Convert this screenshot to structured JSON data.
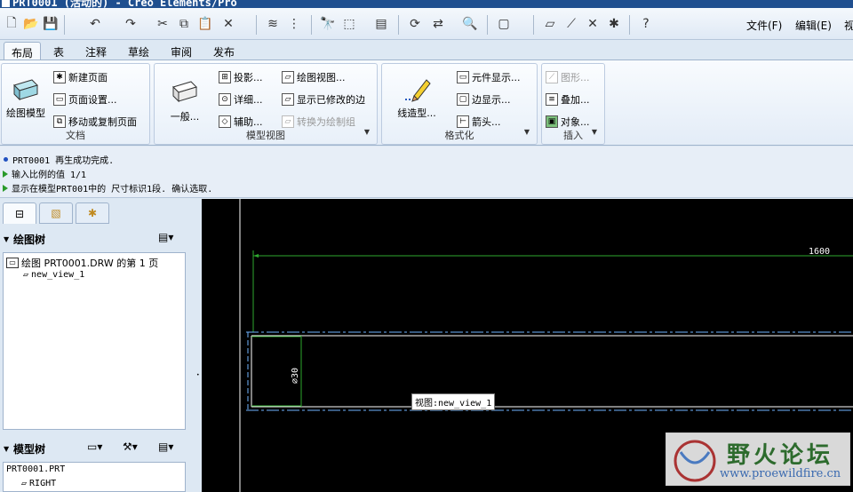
{
  "title_bar": {
    "title": "PRT0001 (活动的) - Creo Elements/Pro"
  },
  "menu": {
    "items": [
      "文件(F)",
      "编辑(E)",
      "视"
    ]
  },
  "tabs": [
    "布局",
    "表",
    "注释",
    "草绘",
    "审阅",
    "发布"
  ],
  "active_tab": "布局",
  "ribbon": {
    "document": {
      "title": "文档",
      "big_label": "绘图模型",
      "buttons": [
        "新建页面",
        "页面设置...",
        "移动或复制页面"
      ]
    },
    "model_views": {
      "title": "模型视图",
      "big_label": "一般...",
      "col1": [
        "投影...",
        "详细...",
        "辅助..."
      ],
      "col2": [
        "绘图视图...",
        "显示已修改的边",
        "转换为绘制组"
      ]
    },
    "format": {
      "title": "格式化",
      "big_label": "线造型...",
      "buttons": [
        "元件显示...",
        "边显示...",
        "箭头..."
      ]
    },
    "insert": {
      "title": "插入",
      "buttons": [
        "图形...",
        "叠加...",
        "对象..."
      ]
    }
  },
  "messages": [
    "PRT0001 再生成功完成.",
    "输入比例的值  1/1",
    "显示在模型PRT001中的 尺寸标识1段.  确认选取."
  ],
  "drawing_tree": {
    "header": "绘图树",
    "items": [
      "绘图 PRT0001.DRW 的第 1 页",
      "new_view_1"
    ]
  },
  "model_tree": {
    "header": "模型树",
    "items": [
      "PRT0001.PRT",
      "RIGHT"
    ]
  },
  "canvas": {
    "dimension_length": "1600",
    "dimension_diameter": "⌀30",
    "view_label": "视图:new_view_1"
  },
  "watermark": {
    "title": "野火论坛",
    "url": "www.proewildfire.cn"
  },
  "colors": {
    "accent": "#1f4f8f",
    "geometry": "#ffffff",
    "dimension": "#2ea82e",
    "centerline": "#6fb3ff"
  }
}
